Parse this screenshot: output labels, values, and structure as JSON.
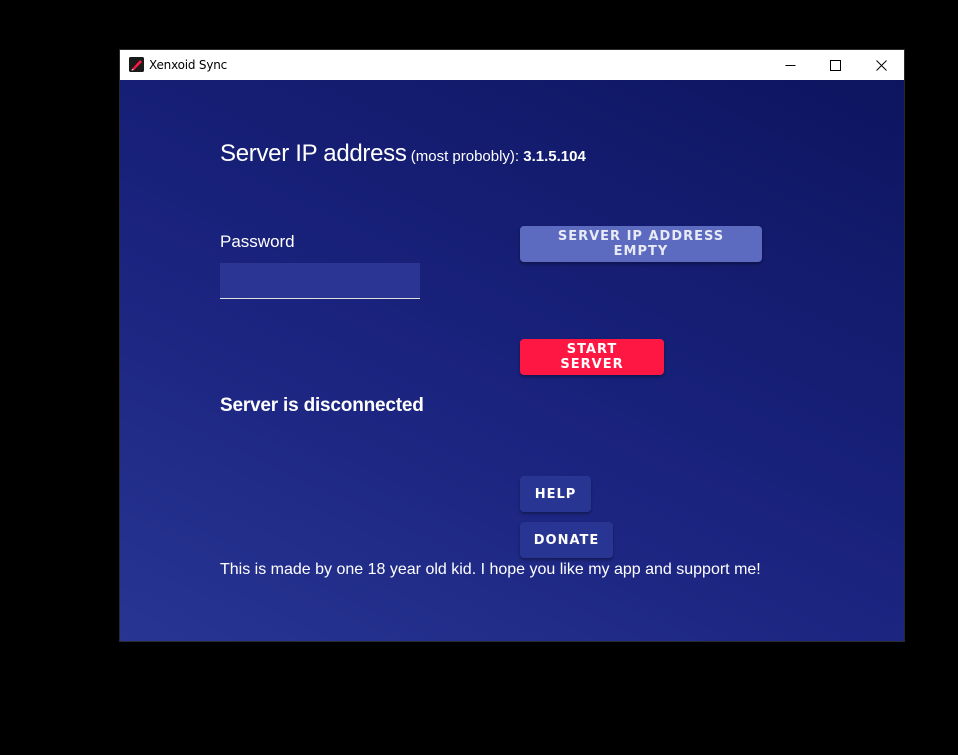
{
  "window": {
    "title": "Xenxoid Sync",
    "icon": "xenxoid-app-icon",
    "controls": {
      "minimize": "minimize-icon",
      "maximize": "maximize-icon",
      "close": "close-icon"
    }
  },
  "server_ip": {
    "heading": "Server IP address",
    "note": " (most probobly): ",
    "value": "3.1.5.104"
  },
  "buttons": {
    "server_ip_status": "SERVER IP ADDRESS EMPTY",
    "start_server": "START SERVER",
    "help": "HELP",
    "donate": "DONATE"
  },
  "password": {
    "label": "Password",
    "value": "",
    "placeholder": ""
  },
  "status": {
    "text": "Server is disconnected"
  },
  "footer": {
    "text": "This is made by one 18 year old kid. I hope you like my app and support me!"
  },
  "colors": {
    "background_gradient_start": "#283593",
    "background_gradient_end": "#0d1560",
    "primary_button": "#5c6bc0",
    "accent_button": "#ff1744",
    "secondary_button": "#283593",
    "text": "#ffffff"
  }
}
